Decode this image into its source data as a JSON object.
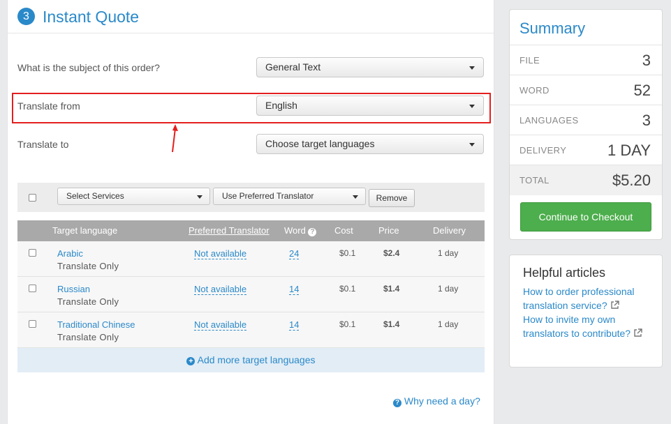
{
  "header": {
    "step_number": "3",
    "title": "Instant Quote"
  },
  "form": {
    "subject_label": "What is the subject of this order?",
    "subject_value": "General Text",
    "from_label": "Translate from",
    "from_value": "English",
    "to_label": "Translate to",
    "to_value": "Choose target languages"
  },
  "toolbar": {
    "services_label": "Select Services",
    "translator_label": "Use Preferred Translator",
    "remove_label": "Remove"
  },
  "table": {
    "headers": {
      "target_language": "Target language",
      "preferred_translator": "Preferred Translator",
      "word": "Word",
      "cost": "Cost",
      "price": "Price",
      "delivery": "Delivery"
    },
    "rows": [
      {
        "language": "Arabic",
        "service": "Translate Only",
        "translator": "Not available",
        "word": "24",
        "cost": "$0.1",
        "price": "$2.4",
        "delivery": "1 day"
      },
      {
        "language": "Russian",
        "service": "Translate Only",
        "translator": "Not available",
        "word": "14",
        "cost": "$0.1",
        "price": "$1.4",
        "delivery": "1 day"
      },
      {
        "language": "Traditional Chinese",
        "service": "Translate Only",
        "translator": "Not available",
        "word": "14",
        "cost": "$0.1",
        "price": "$1.4",
        "delivery": "1 day"
      }
    ],
    "add_more_label": "Add more target languages"
  },
  "why_need_label": "Why need a day?",
  "summary": {
    "title": "Summary",
    "rows": [
      {
        "label": "FILE",
        "value": "3"
      },
      {
        "label": "WORD",
        "value": "52"
      },
      {
        "label": "LANGUAGES",
        "value": "3"
      },
      {
        "label": "DELIVERY",
        "value": "1 DAY"
      },
      {
        "label": "TOTAL",
        "value": "$5.20"
      }
    ],
    "checkout_label": "Continue to Checkout"
  },
  "articles": {
    "title": "Helpful articles",
    "links": [
      {
        "text": "How to order professional translation service?"
      },
      {
        "text": "How to invite my own translators to contribute?"
      }
    ]
  },
  "colors": {
    "accent": "#2a89c9",
    "success": "#4cae4c",
    "highlight": "#e41e1e"
  },
  "icons": [
    "question-circle-icon",
    "plus-circle-icon",
    "external-link-icon",
    "chevron-down-icon",
    "red-arrow-annotation"
  ]
}
